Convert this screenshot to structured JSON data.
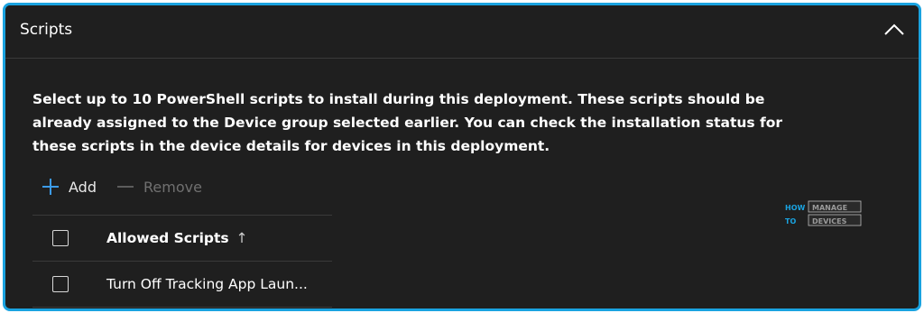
{
  "section": {
    "title": "Scripts"
  },
  "description": "Select up to 10 PowerShell scripts to install during this deployment. These scripts should be already assigned to the Device group selected earlier. You can check the installation status for these scripts in the device details for devices in this deployment.",
  "toolbar": {
    "add_label": "Add",
    "remove_label": "Remove"
  },
  "table": {
    "column_header": "Allowed Scripts",
    "sort_indicator": "↑",
    "rows": [
      {
        "name": "Turn Off Tracking App Laun..."
      }
    ]
  },
  "watermark": {
    "line1_left": "HOW",
    "line1_right": "MANAGE",
    "line2_left": "TO",
    "line2_right": "DEVICES"
  },
  "colors": {
    "border_accent": "#1aa3e0",
    "panel_bg": "#1f1f1f",
    "add_icon": "#3c9be8",
    "disabled_text": "#707070"
  }
}
